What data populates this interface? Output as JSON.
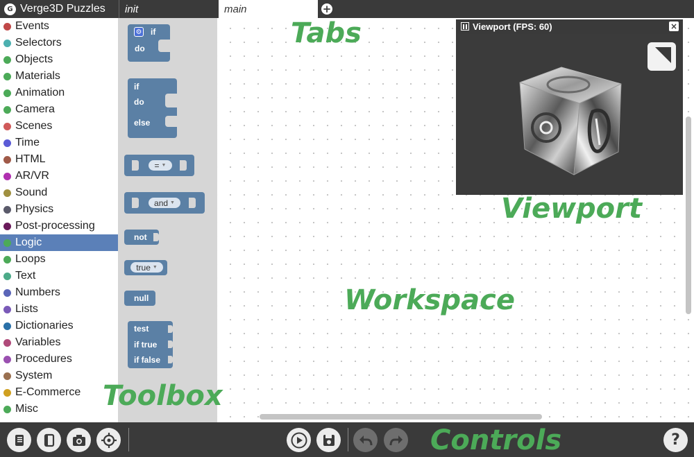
{
  "app": {
    "title": "Verge3D Puzzles",
    "logo_glyph": "G"
  },
  "tabs": [
    {
      "label": "init"
    },
    {
      "label": "main"
    }
  ],
  "tab_add_icon": "+",
  "categories": [
    {
      "label": "Events",
      "color": "#c04848"
    },
    {
      "label": "Selectors",
      "color": "#4cb0b0"
    },
    {
      "label": "Objects",
      "color": "#4caa58"
    },
    {
      "label": "Materials",
      "color": "#4caa58"
    },
    {
      "label": "Animation",
      "color": "#4caa58"
    },
    {
      "label": "Camera",
      "color": "#4caa58"
    },
    {
      "label": "Scenes",
      "color": "#d05a5a"
    },
    {
      "label": "Time",
      "color": "#5b5bd6"
    },
    {
      "label": "HTML",
      "color": "#a05a48"
    },
    {
      "label": "AR/VR",
      "color": "#b030b0"
    },
    {
      "label": "Sound",
      "color": "#a09040"
    },
    {
      "label": "Physics",
      "color": "#5a5a6a"
    },
    {
      "label": "Post-processing",
      "color": "#6a1a5a"
    },
    {
      "label": "Logic",
      "color": "#5b80b8",
      "selected": true
    },
    {
      "label": "Loops",
      "color": "#4caa58"
    },
    {
      "label": "Text",
      "color": "#4caa88"
    },
    {
      "label": "Numbers",
      "color": "#5b66b8"
    },
    {
      "label": "Lists",
      "color": "#7a5ab8"
    },
    {
      "label": "Dictionaries",
      "color": "#2a70a8"
    },
    {
      "label": "Variables",
      "color": "#b04a7a"
    },
    {
      "label": "Procedures",
      "color": "#9a50b0"
    },
    {
      "label": "System",
      "color": "#9a7050"
    },
    {
      "label": "E-Commerce",
      "color": "#d0a020"
    },
    {
      "label": "Misc",
      "color": "#4caa58"
    }
  ],
  "toolbox": {
    "if_do": {
      "if": "if",
      "do": "do"
    },
    "if_do_else": {
      "if": "if",
      "do": "do",
      "else": "else"
    },
    "compare": {
      "operator": "="
    },
    "logic_op": {
      "operator": "and"
    },
    "not": "not",
    "boolean": {
      "value": "true"
    },
    "null": "null",
    "ternary": {
      "test": "test",
      "if_true": "if true",
      "if_false": "if false"
    }
  },
  "viewport": {
    "title": "Viewport (FPS: 60)",
    "close_icon": "×"
  },
  "annotations": {
    "tabs": "Tabs",
    "viewport": "Viewport",
    "workspace": "Workspace",
    "toolbox": "Toolbox",
    "controls": "Controls"
  },
  "controls": {
    "left": [
      "manual-icon",
      "library-icon",
      "screenshot-icon",
      "target-icon"
    ],
    "center": [
      "play-icon",
      "save-icon",
      "undo-icon",
      "redo-icon"
    ],
    "right": [
      "help-icon"
    ],
    "help_label": "?"
  },
  "colors": {
    "accent": "#4caa58",
    "block": "#5b80a5",
    "selected": "#5b80b8",
    "chrome": "#3a3a3a"
  }
}
